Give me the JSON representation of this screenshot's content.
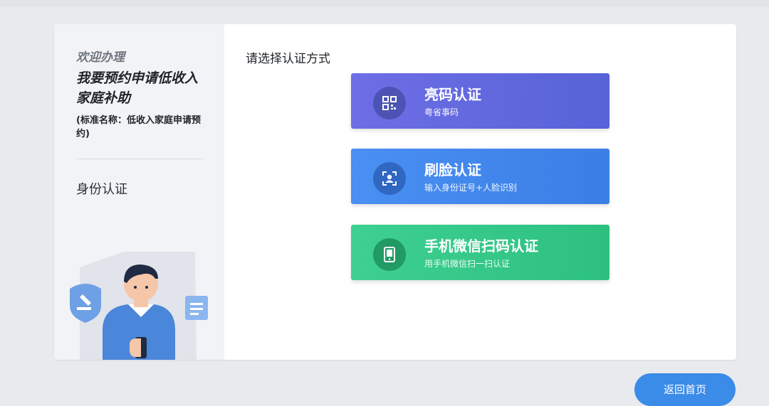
{
  "sidebar": {
    "welcome": "欢迎办理",
    "service_title": "我要预约申请低收入家庭补助",
    "standard_name": "(标准名称：低收入家庭申请预约)",
    "step": "身份认证"
  },
  "main": {
    "prompt": "请选择认证方式",
    "options": [
      {
        "title": "亮码认证",
        "subtitle": "粤省事码",
        "icon": "qr-code-icon",
        "color": "#6366e0"
      },
      {
        "title": "刷脸认证",
        "subtitle": "输入身份证号+人脸识别",
        "icon": "face-scan-icon",
        "color": "#4388ed"
      },
      {
        "title": "手机微信扫码认证",
        "subtitle": "用手机微信扫一扫认证",
        "icon": "phone-icon",
        "color": "#36c98a"
      }
    ]
  },
  "footer": {
    "home_button": "返回首页"
  }
}
